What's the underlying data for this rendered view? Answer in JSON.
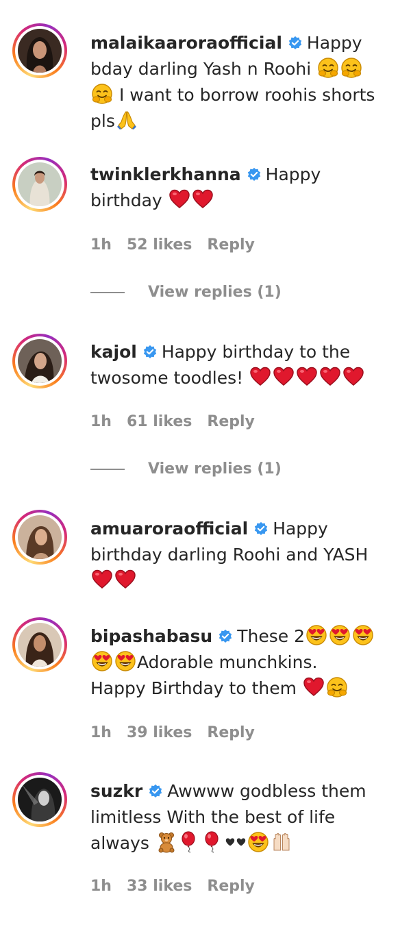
{
  "colors": {
    "verified": "#3897f0",
    "meta": "#8e8e8e",
    "text": "#262626",
    "heart": "#e0182d"
  },
  "comments": [
    {
      "username": "malaikaaroraofficial",
      "lines": [
        "Happy",
        "bday darling Yash n Roohi",
        "I want to borrow roohis shorts",
        "pls"
      ]
    },
    {
      "username": "twinklerkhanna",
      "lines": [
        "Happy",
        "birthday"
      ],
      "time": "1h",
      "likes": "52 likes",
      "reply": "Reply",
      "view_replies": "View replies (1)"
    },
    {
      "username": "kajol",
      "lines": [
        "Happy birthday to the",
        "twosome toodles!"
      ],
      "time": "1h",
      "likes": "61 likes",
      "reply": "Reply",
      "view_replies": "View replies (1)"
    },
    {
      "username": "amuaroraofficial",
      "lines": [
        "Happy",
        "birthday darling Roohi and YASH"
      ]
    },
    {
      "username": "bipashabasu",
      "lines": [
        "These 2",
        "Adorable munchkins.",
        "Happy Birthday to them"
      ],
      "time": "1h",
      "likes": "39 likes",
      "reply": "Reply"
    },
    {
      "username": "suzkr",
      "lines": [
        "Awwww godbless them",
        "limitless With the best of life",
        "always"
      ],
      "time": "1h",
      "likes": "33 likes",
      "reply": "Reply"
    }
  ]
}
